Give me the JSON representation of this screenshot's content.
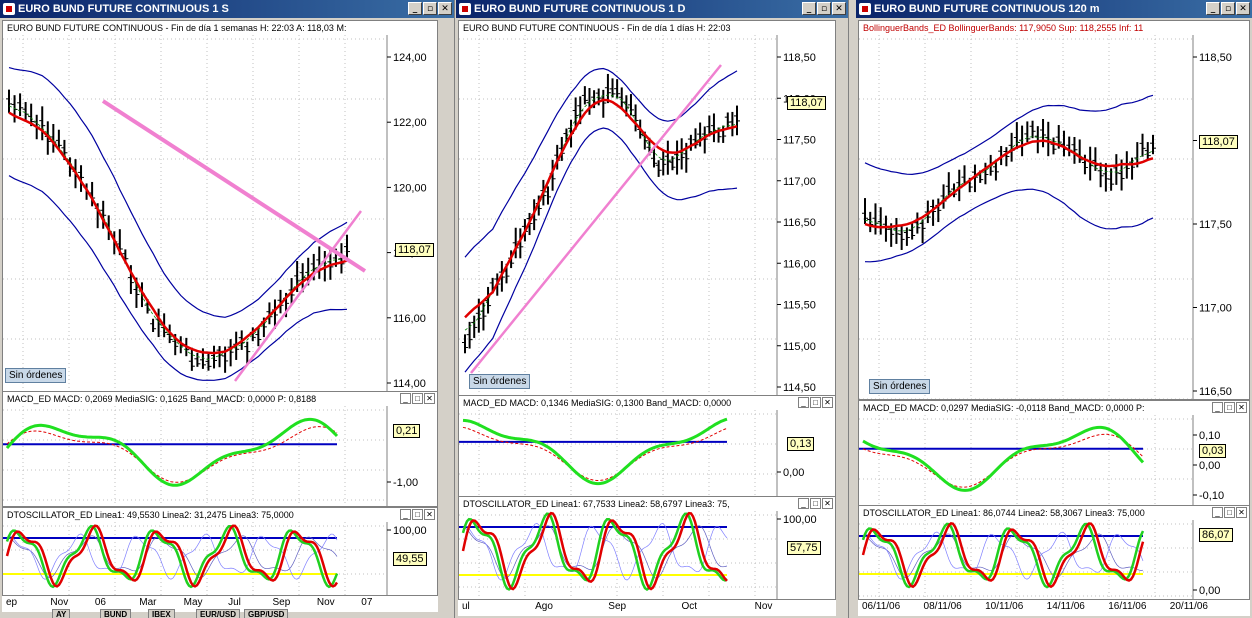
{
  "windows": [
    {
      "title": "EURO BUND FUTURE CONTINUOUS 1 S",
      "price_header": "EURO BUND FUTURE CONTINUOUS - Fin de día 1 semanas  H: 22:03  A: 118,03  M:",
      "price_axis": [
        "124,00",
        "122,00",
        "120,00",
        "118,00",
        "116,00",
        "114,00"
      ],
      "last_price": "118,07",
      "orders_label": "Sin órdenes",
      "macd_header": "MACD_ED  MACD: 0,2069  MediaSIG: 0,1625  Band_MACD: 0,0000  P: 0,8188",
      "macd_axis": [
        "-1,00"
      ],
      "macd_last": "0,21",
      "osc_header": "DTOSCILLATOR_ED  Linea1: 49,5530  Linea2: 31,2475  Linea3: 75,0000",
      "osc_axis": [
        "100,00"
      ],
      "osc_last": "49,55",
      "x_labels": [
        "ep",
        "Nov",
        "06",
        "Mar",
        "May",
        "Jul",
        "Sep",
        "Nov",
        "07"
      ],
      "tabs": [
        "AY",
        "BUND",
        "IBEX",
        "EUR/USD",
        "GBP/USD"
      ]
    },
    {
      "title": "EURO BUND FUTURE CONTINUOUS 1 D",
      "price_header": "EURO BUND FUTURE CONTINUOUS - Fin de día 1 días  H: 22:03",
      "price_axis": [
        "118,50",
        "118,00",
        "117,50",
        "117,00",
        "116,50",
        "116,00",
        "115,50",
        "115,00",
        "114,50"
      ],
      "last_price": "118,07",
      "orders_label": "Sin órdenes",
      "macd_header": "MACD_ED  MACD: 0,1346  MediaSIG: 0,1300  Band_MACD: 0,0000",
      "macd_axis": [
        "0,00"
      ],
      "macd_last": "0,13",
      "osc_header": "DTOSCILLATOR_ED  Linea1: 67,7533  Linea2: 58,6797  Linea3: 75,",
      "osc_axis": [
        "100,00"
      ],
      "osc_last": "57,75",
      "x_labels": [
        "ul",
        "Ago",
        "Sep",
        "Oct",
        "Nov"
      ]
    },
    {
      "title": "EURO BUND FUTURE CONTINUOUS 120 m",
      "price_header": "BollinguerBands_ED  BollinguerBands: 117,9050  Sup: 118,2555  Inf: 11",
      "price_axis": [
        "118,50",
        "118,00",
        "117,50",
        "117,00",
        "116,50"
      ],
      "last_price": "118,07",
      "orders_label": "Sin órdenes",
      "macd_header": "MACD_ED  MACD: 0,0297  MediaSIG: -0,0118  Band_MACD: 0,0000  P:",
      "macd_axis": [
        "0,10",
        "0,00",
        "-0,10"
      ],
      "macd_last": "0,03",
      "osc_header": "DTOSCILLATOR_ED  Linea1: 86,0744  Linea2: 58,3067  Linea3: 75,000",
      "osc_axis": [
        "0,00"
      ],
      "osc_last": "86,07",
      "x_labels": [
        "06/11/06",
        "08/11/06",
        "10/11/06",
        "14/11/06",
        "16/11/06",
        "20/11/06"
      ]
    }
  ],
  "colors": {
    "price_bars": "#000000",
    "moving_average": "#e00000",
    "bands": "#0000a0",
    "trendline": "#f080d0",
    "macd_line": "#20e020",
    "signal_line": "#e00000",
    "zero_line": "#0000c0",
    "osc_line1": "#e00000",
    "osc_line2": "#20d020",
    "osc_level": "#ffff00"
  },
  "icons": [
    "minimize-icon",
    "restore-icon",
    "close-icon"
  ]
}
